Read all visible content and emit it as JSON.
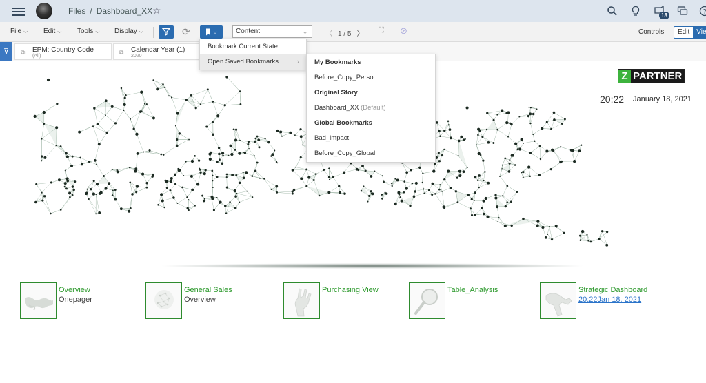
{
  "shell": {
    "breadcrumb_root": "Files",
    "breadcrumb_sep": "/",
    "breadcrumb_current": "Dashboard_XX",
    "notification_count": "18",
    "icons": [
      "search-icon",
      "lightbulb-icon",
      "notifications-icon",
      "chat-icon",
      "help-icon"
    ]
  },
  "toolbar": {
    "file": "File",
    "edit": "Edit",
    "tools": "Tools",
    "display": "Display",
    "page_select": "Content",
    "page_indicator": "1 / 5",
    "controls": "Controls",
    "edit_mode": "Edit",
    "view_mode": "View"
  },
  "filters": [
    {
      "label": "EPM: Country Code",
      "value": "(All)"
    },
    {
      "label": "Calendar Year (1)",
      "value": "2020"
    }
  ],
  "bookmark_menu": {
    "items": [
      {
        "label": "Bookmark Current State"
      },
      {
        "label": "Open Saved Bookmarks"
      }
    ]
  },
  "saved_bookmarks": {
    "my_header": "My Bookmarks",
    "my_items": [
      "Before_Copy_Perso..."
    ],
    "original_header": "Original Story",
    "original_item": "Dashboard_XX",
    "original_tag": "(Default)",
    "global_header": "Global Bookmarks",
    "global_items": [
      "Bad_impact",
      "Before_Copy_Global"
    ]
  },
  "header": {
    "logo_z": "Z",
    "logo_text": "PARTNER",
    "time": "20:22",
    "date": "January 18, 2021"
  },
  "tiles": [
    {
      "title": "Overview",
      "subtitle": "Onepager"
    },
    {
      "title": "General Sales",
      "subtitle": "Overview"
    },
    {
      "title": "Purchasing View",
      "subtitle": ""
    },
    {
      "title": "Table_Analysis",
      "subtitle": ""
    },
    {
      "title": "Strategic Dashboard",
      "subtitle": "20:22Jan 18, 2021"
    }
  ],
  "colors": {
    "shell_bg": "#dde5ee",
    "accent": "#2b6cb0",
    "link_green": "#2e9a2e",
    "logo_green": "#3db33d"
  }
}
